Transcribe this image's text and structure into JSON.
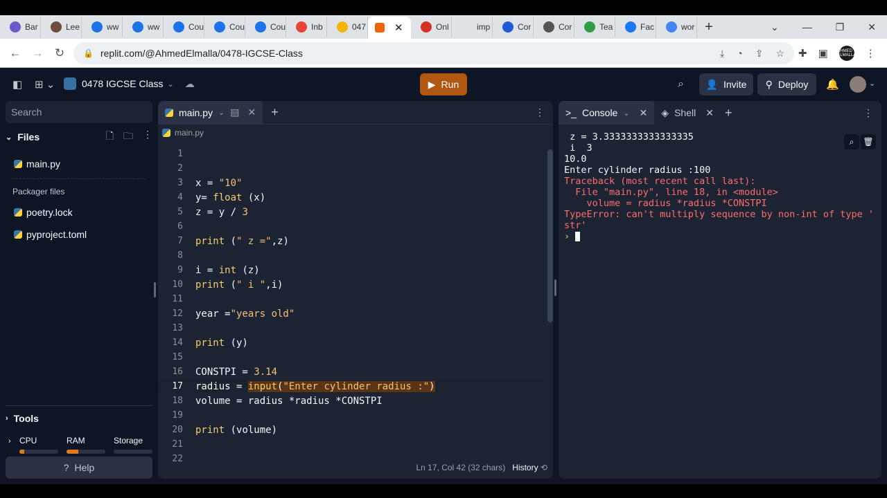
{
  "browser": {
    "tabs": [
      {
        "label": "Bar",
        "icon": "sparkle-icon",
        "color": "#6a5acd"
      },
      {
        "label": "Lee",
        "icon": "person-icon",
        "color": "#6b4e3d"
      },
      {
        "label": "ww",
        "icon": "c-logo-icon",
        "color": "#1a73e8"
      },
      {
        "label": "ww",
        "icon": "c-logo-icon",
        "color": "#1a73e8"
      },
      {
        "label": "Cou",
        "icon": "c-logo-icon",
        "color": "#1a73e8"
      },
      {
        "label": "Cou",
        "icon": "c-logo-icon",
        "color": "#1a73e8"
      },
      {
        "label": "Cou",
        "icon": "c-logo-icon",
        "color": "#1a73e8"
      },
      {
        "label": "Inb",
        "icon": "gmail-icon",
        "color": "#ea4335"
      },
      {
        "label": "047",
        "icon": "slides-icon",
        "color": "#f4b400"
      }
    ],
    "active_tab_icon": "replit-icon",
    "tabs_after": [
      {
        "label": "Onl",
        "icon": "code-icon",
        "color": "#d93025"
      },
      {
        "label": "imp",
        "icon": "blank-icon",
        "color": "#dfe3e8"
      },
      {
        "label": "Cor",
        "icon": "k-logo-icon",
        "color": "#1e5bd6"
      },
      {
        "label": "Cor",
        "icon": "info-icon",
        "color": "#555555"
      },
      {
        "label": "Tea",
        "icon": "flag-icon",
        "color": "#2e9e44"
      },
      {
        "label": "Fac",
        "icon": "facebook-icon",
        "color": "#1877f2"
      },
      {
        "label": "wor",
        "icon": "google-icon",
        "color": "#4285f4"
      }
    ],
    "url": "replit.com/@AhmedElmalla/0478-IGCSE-Class",
    "profile_text": "AHMED ELMALLA"
  },
  "replit": {
    "repl_name": "0478 IGCSE Class",
    "run_label": "Run",
    "invite_label": "Invite",
    "deploy_label": "Deploy",
    "accent_run": "#b05712"
  },
  "sidebar": {
    "search_placeholder": "Search",
    "files_label": "Files",
    "files": [
      "main.py"
    ],
    "packager_label": "Packager files",
    "packager_files": [
      "poetry.lock",
      "pyproject.toml"
    ],
    "tools_label": "Tools",
    "meters": [
      {
        "label": "CPU",
        "fill": 0.12
      },
      {
        "label": "RAM",
        "fill": 0.3
      },
      {
        "label": "Storage",
        "fill": 0.0
      }
    ],
    "help_label": "Help"
  },
  "editor": {
    "tab_label": "main.py",
    "breadcrumb": "main.py",
    "current_line": 17,
    "status": "Ln 17, Col 42 (32 chars)",
    "history_label": "History",
    "lines": [
      {
        "n": "1",
        "text": ""
      },
      {
        "n": "2",
        "text": ""
      },
      {
        "n": "3",
        "text": "x = \"10\""
      },
      {
        "n": "4",
        "text": "y= float (x)"
      },
      {
        "n": "5",
        "text": "z = y / 3"
      },
      {
        "n": "6",
        "text": ""
      },
      {
        "n": "7",
        "text": "print (\" z =\",z)"
      },
      {
        "n": "8",
        "text": ""
      },
      {
        "n": "9",
        "text": "i = int (z)"
      },
      {
        "n": "10",
        "text": "print (\" i \",i)"
      },
      {
        "n": "11",
        "text": ""
      },
      {
        "n": "12",
        "text": "year =\"years old\""
      },
      {
        "n": "13",
        "text": ""
      },
      {
        "n": "14",
        "text": "print (y)"
      },
      {
        "n": "15",
        "text": ""
      },
      {
        "n": "16",
        "text": "CONSTPI = 3.14"
      },
      {
        "n": "17",
        "text": "radius = input(\"Enter cylinder radius :\")"
      },
      {
        "n": "18",
        "text": "volume = radius *radius *CONSTPI"
      },
      {
        "n": "19",
        "text": ""
      },
      {
        "n": "20",
        "text": "print (volume)"
      },
      {
        "n": "21",
        "text": ""
      },
      {
        "n": "22",
        "text": ""
      }
    ]
  },
  "console": {
    "tab_label": "Console",
    "shell_label": "Shell",
    "output": [
      {
        "text": " z = 3.3333333333333335",
        "kind": "out"
      },
      {
        "text": " i  3",
        "kind": "out"
      },
      {
        "text": "10.0",
        "kind": "out"
      },
      {
        "text": "Enter cylinder radius :100",
        "kind": "out"
      },
      {
        "text": "Traceback (most recent call last):",
        "kind": "err"
      },
      {
        "text": "  File \"main.py\", line 18, in <module>",
        "kind": "err"
      },
      {
        "text": "    volume = radius *radius *CONSTPI",
        "kind": "err"
      },
      {
        "text": "TypeError: can't multiply sequence by non-int of type '",
        "kind": "err"
      },
      {
        "text": "str'",
        "kind": "err"
      }
    ],
    "prompt_symbol": "›"
  }
}
